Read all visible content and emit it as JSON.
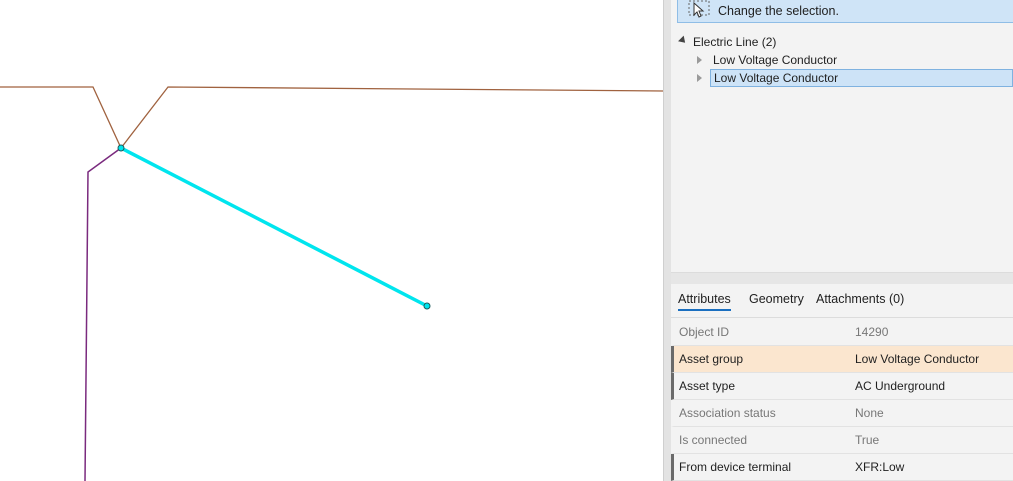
{
  "banner": {
    "text": "Change the selection.",
    "icon": "select-cursor-icon"
  },
  "tree": {
    "root": {
      "label": "Electric Line (2)"
    },
    "children": [
      {
        "label": "Low Voltage Conductor",
        "selected": false
      },
      {
        "label": "Low Voltage Conductor",
        "selected": true
      }
    ]
  },
  "tabs": [
    {
      "label": "Attributes",
      "active": true
    },
    {
      "label": "Geometry",
      "active": false
    },
    {
      "label": "Attachments (0)",
      "active": false
    }
  ],
  "attributes": [
    {
      "key": "Object ID",
      "value": "14290",
      "editable": false,
      "highlight": false
    },
    {
      "key": "Asset group",
      "value": "Low Voltage Conductor",
      "editable": true,
      "highlight": true
    },
    {
      "key": "Asset type",
      "value": "AC Underground",
      "editable": true,
      "highlight": false
    },
    {
      "key": "Association status",
      "value": "None",
      "editable": false,
      "highlight": false
    },
    {
      "key": "Is connected",
      "value": "True",
      "editable": false,
      "highlight": false
    },
    {
      "key": "From device terminal",
      "value": "XFR:Low",
      "editable": true,
      "highlight": false
    }
  ],
  "colors": {
    "selected_line": "#00e5ee",
    "brown_line": "#a0623f",
    "purple_line": "#7a2a7e",
    "accent": "#1a6fc0",
    "highlight_row": "#fbe6cf"
  }
}
